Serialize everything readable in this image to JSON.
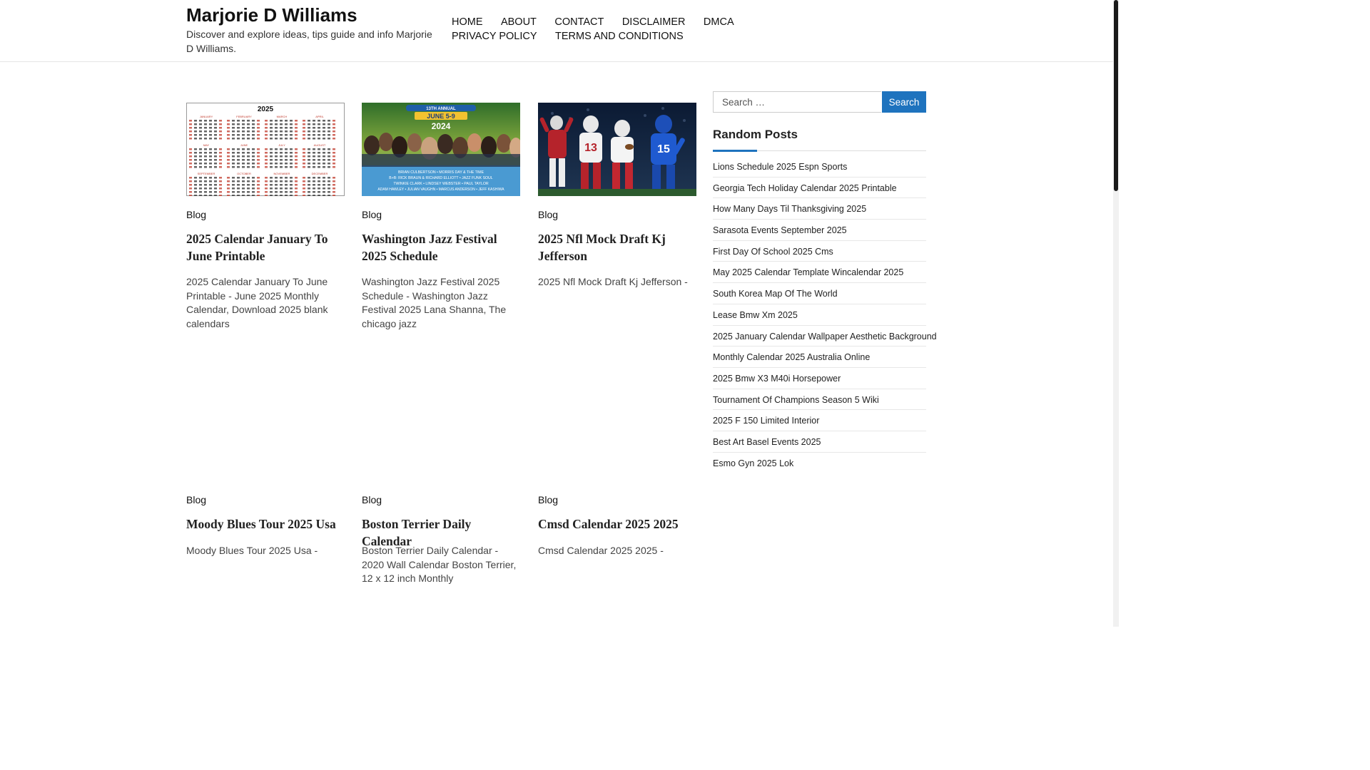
{
  "site": {
    "title": "Marjorie D Williams",
    "description": "Discover and explore ideas, tips guide and info Marjorie D Williams."
  },
  "nav": {
    "items": [
      "HOME",
      "ABOUT",
      "CONTACT",
      "DISCLAIMER",
      "DMCA",
      "PRIVACY POLICY",
      "TERMS AND CONDITIONS"
    ]
  },
  "posts": [
    {
      "category": "Blog",
      "title": "2025 Calendar January To June Printable",
      "excerpt": "2025 Calendar January To June Printable - June 2025 Monthly Calendar, Download 2025 blank calendars",
      "image": "calendar-2025-thumbnail"
    },
    {
      "category": "Blog",
      "title": "Washington Jazz Festival 2025 Schedule",
      "excerpt": "Washington Jazz Festival 2025 Schedule - Washington Jazz Festival 2025 Lana Shanna, The chicago jazz",
      "image": "jazz-festival-poster-thumbnail"
    },
    {
      "category": "Blog",
      "title": "2025 Nfl Mock Draft Kj Jefferson",
      "excerpt": "2025 Nfl Mock Draft Kj Jefferson -",
      "image": "football-players-thumbnail"
    },
    {
      "category": "Blog",
      "title": "Moody Blues Tour 2025 Usa",
      "excerpt": "Moody Blues Tour 2025 Usa -"
    },
    {
      "category": "Blog",
      "title": "Boston Terrier Daily Calendar",
      "excerpt": "Boston Terrier Daily Calendar - 2020 Wall Calendar Boston Terrier, 12 x 12 inch Monthly"
    },
    {
      "category": "Blog",
      "title": "Cmsd Calendar 2025 2025",
      "excerpt": "Cmsd Calendar 2025 2025 -"
    }
  ],
  "thumbnails": {
    "calendar": {
      "year": "2025",
      "months": [
        "JANUARY",
        "FEBRUARY",
        "MARCH",
        "APRIL",
        "MAY",
        "JUNE",
        "JULY",
        "AUGUST",
        "SEPTEMBER",
        "OCTOBER",
        "NOVEMBER",
        "DECEMBER"
      ]
    },
    "jazz": {
      "banner": "13TH ANNUAL",
      "dates": "JUNE 5-9",
      "year": "2024",
      "lineup_1": "BRIAN CULBERTSON • MORRIS DAY & THE TIME",
      "lineup_2": "B+B: RICK BRAUN & RICHARD ELLIOTT • JAZZ FUNK SOUL",
      "lineup_3": "TWINKIE CLARK • LINDSEY WEBSTER • PAUL TAYLOR",
      "lineup_4": "ADAM HAWLEY • JULIAN VAUGHN • MARCUS ANDERSON • JEFF KASHIWA"
    },
    "football": {
      "number_left": "13",
      "number_right": "15"
    }
  },
  "sidebar": {
    "search": {
      "placeholder": "Search …",
      "button_label": "Search"
    },
    "widget_title": "Random Posts",
    "random_posts": [
      "Lions Schedule 2025 Espn Sports",
      "Georgia Tech Holiday Calendar 2025 Printable",
      "How Many Days Til Thanksgiving 2025",
      "Sarasota Events September 2025",
      "First Day Of School 2025 Cms",
      "May 2025 Calendar Template Wincalendar 2025",
      "South Korea Map Of The World",
      "Lease Bmw Xm 2025",
      "2025 January Calendar Wallpaper Aesthetic Background",
      "Monthly Calendar 2025 Australia Online",
      "2025 Bmw X3 M40i Horsepower",
      "Tournament Of Champions Season 5 Wiki",
      "2025 F 150 Limited Interior",
      "Best Art Basel Events 2025",
      "Esmo Gyn 2025 Lok"
    ]
  },
  "colors": {
    "accent": "#1e73be",
    "text": "#333333",
    "title": "#222222"
  }
}
